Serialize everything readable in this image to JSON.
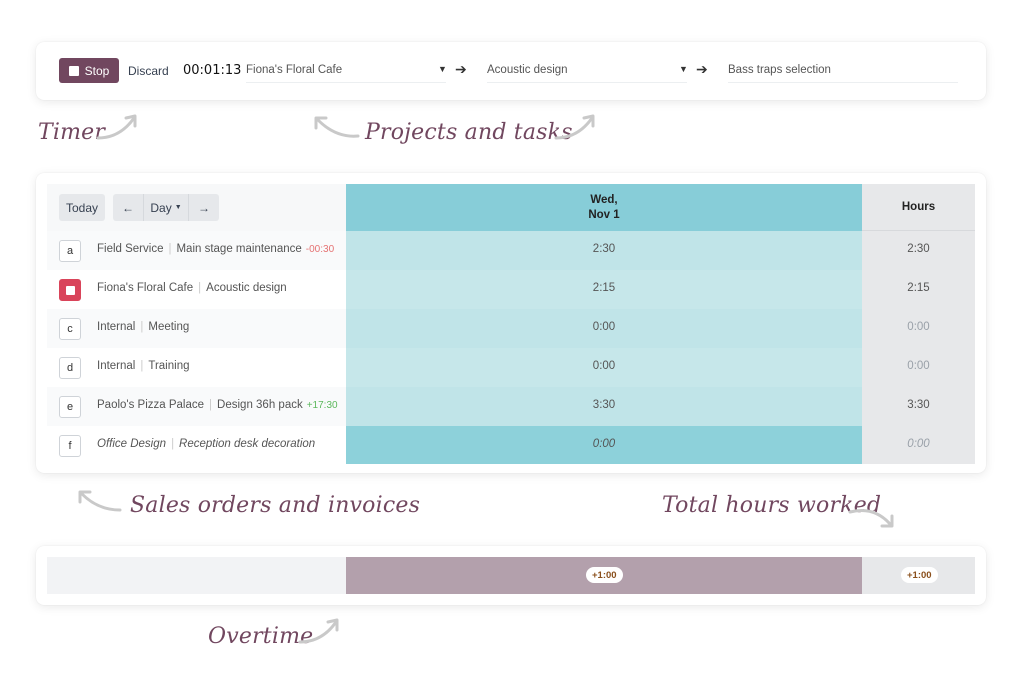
{
  "timer": {
    "stop_label": "Stop",
    "discard_label": "Discard",
    "elapsed": "00:01:13",
    "project": "Fiona's Floral Cafe",
    "task": "Acoustic design",
    "description": "Bass traps selection"
  },
  "annotations": {
    "timer": "Timer",
    "projects": "Projects and tasks",
    "sales": "Sales orders and invoices",
    "total": "Total hours worked",
    "overtime": "Overtime"
  },
  "grid": {
    "today_label": "Today",
    "view_label": "Day",
    "day_header_line1": "Wed,",
    "day_header_line2": "Nov 1",
    "hours_header": "Hours",
    "rows": [
      {
        "key": "a",
        "project": "Field Service",
        "task": "Main stage maintenance",
        "delta": "-00:30",
        "day": "2:30",
        "total": "2:30"
      },
      {
        "key": "",
        "project": "Fiona's Floral Cafe",
        "task": "Acoustic design",
        "delta": "",
        "day": "2:15",
        "total": "2:15"
      },
      {
        "key": "c",
        "project": "Internal",
        "task": "Meeting",
        "delta": "",
        "day": "0:00",
        "total": "0:00"
      },
      {
        "key": "d",
        "project": "Internal",
        "task": "Training",
        "delta": "",
        "day": "0:00",
        "total": "0:00"
      },
      {
        "key": "e",
        "project": "Paolo's Pizza Palace",
        "task": "Design 36h pack",
        "delta": "+17:30",
        "day": "3:30",
        "total": "3:30"
      },
      {
        "key": "f",
        "project": "Office Design",
        "task": "Reception desk decoration",
        "delta": "",
        "day": "0:00",
        "total": "0:00"
      }
    ]
  },
  "overtime": {
    "day": "+1:00",
    "total": "+1:00"
  },
  "colors": {
    "primary": "#71475f",
    "active_key": "#d9445a",
    "day_header": "#87cdd8",
    "overtime_bar": "#b3a0ac"
  }
}
